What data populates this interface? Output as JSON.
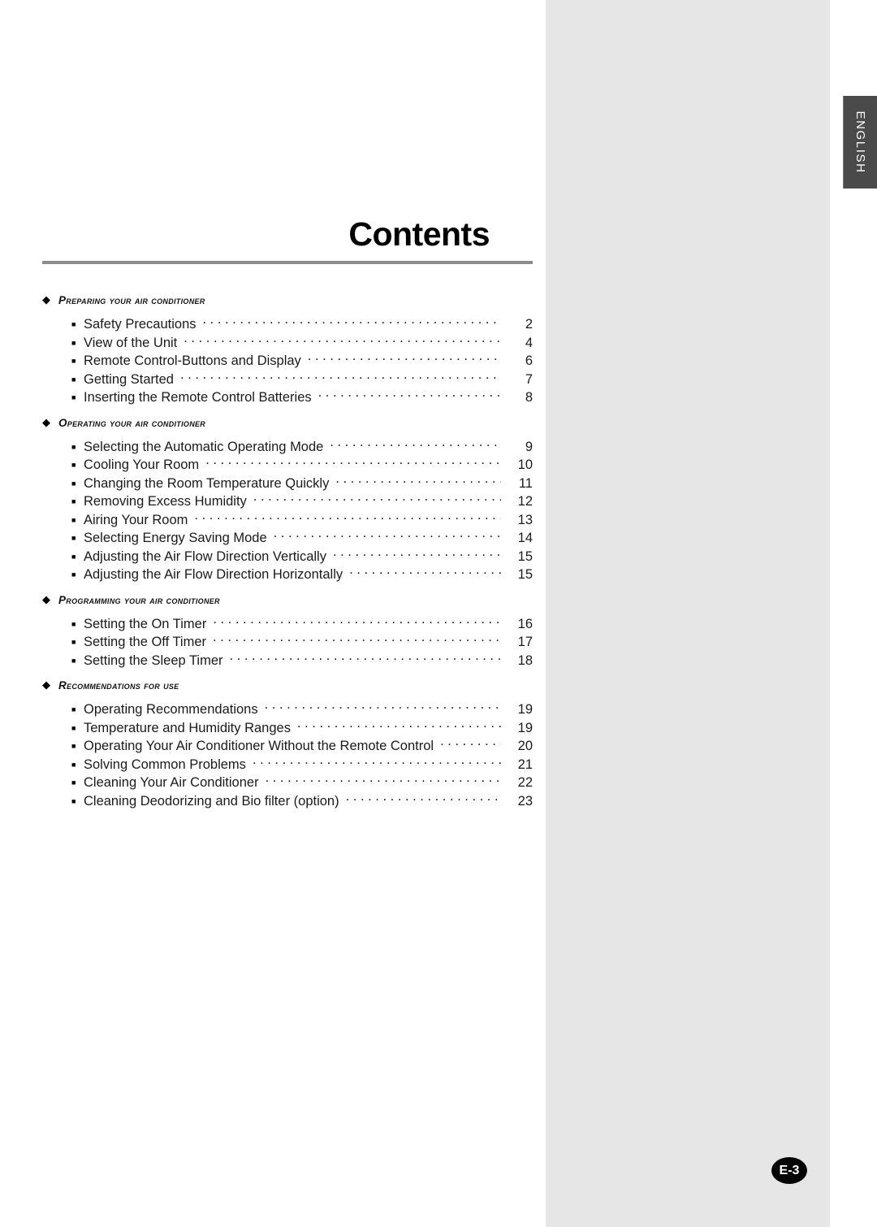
{
  "page": {
    "title": "Contents",
    "badge_label": "E-3",
    "language_tab": "ENGLISH",
    "rule_color": "#8c8c8c",
    "panel_color": "#e6e6e6",
    "tab_color": "#4a4a4a"
  },
  "icons": {
    "diamond": "◆",
    "square": "■"
  },
  "toc": {
    "sections": [
      {
        "heading": "Preparing your air conditioner",
        "entries": [
          {
            "label": "Safety Precautions",
            "page": "2"
          },
          {
            "label": "View of the Unit",
            "page": "4"
          },
          {
            "label": "Remote Control-Buttons and Display",
            "page": "6"
          },
          {
            "label": "Getting Started",
            "page": "7"
          },
          {
            "label": "Inserting the Remote Control Batteries",
            "page": "8"
          }
        ]
      },
      {
        "heading": "Operating your air conditioner",
        "entries": [
          {
            "label": "Selecting the Automatic Operating Mode",
            "page": "9"
          },
          {
            "label": "Cooling Your Room",
            "page": "10"
          },
          {
            "label": "Changing the Room Temperature Quickly",
            "page": "11"
          },
          {
            "label": "Removing Excess Humidity",
            "page": "12"
          },
          {
            "label": "Airing Your Room",
            "page": "13"
          },
          {
            "label": "Selecting Energy Saving Mode",
            "page": "14"
          },
          {
            "label": "Adjusting the Air Flow Direction Vertically",
            "page": "15"
          },
          {
            "label": "Adjusting the Air Flow Direction Horizontally",
            "page": "15"
          }
        ]
      },
      {
        "heading": "Programming your air conditioner",
        "entries": [
          {
            "label": "Setting the On Timer",
            "page": "16"
          },
          {
            "label": "Setting the Off Timer",
            "page": "17"
          },
          {
            "label": "Setting the Sleep Timer",
            "page": "18"
          }
        ]
      },
      {
        "heading": "Recommendations for use",
        "entries": [
          {
            "label": "Operating Recommendations",
            "page": "19"
          },
          {
            "label": "Temperature and Humidity Ranges",
            "page": "19"
          },
          {
            "label": "Operating Your Air Conditioner Without the Remote Control",
            "page": "20"
          },
          {
            "label": "Solving Common Problems",
            "page": "21"
          },
          {
            "label": "Cleaning Your Air Conditioner",
            "page": "22"
          },
          {
            "label": "Cleaning Deodorizing and Bio filter (option)",
            "page": "23"
          }
        ]
      }
    ]
  }
}
